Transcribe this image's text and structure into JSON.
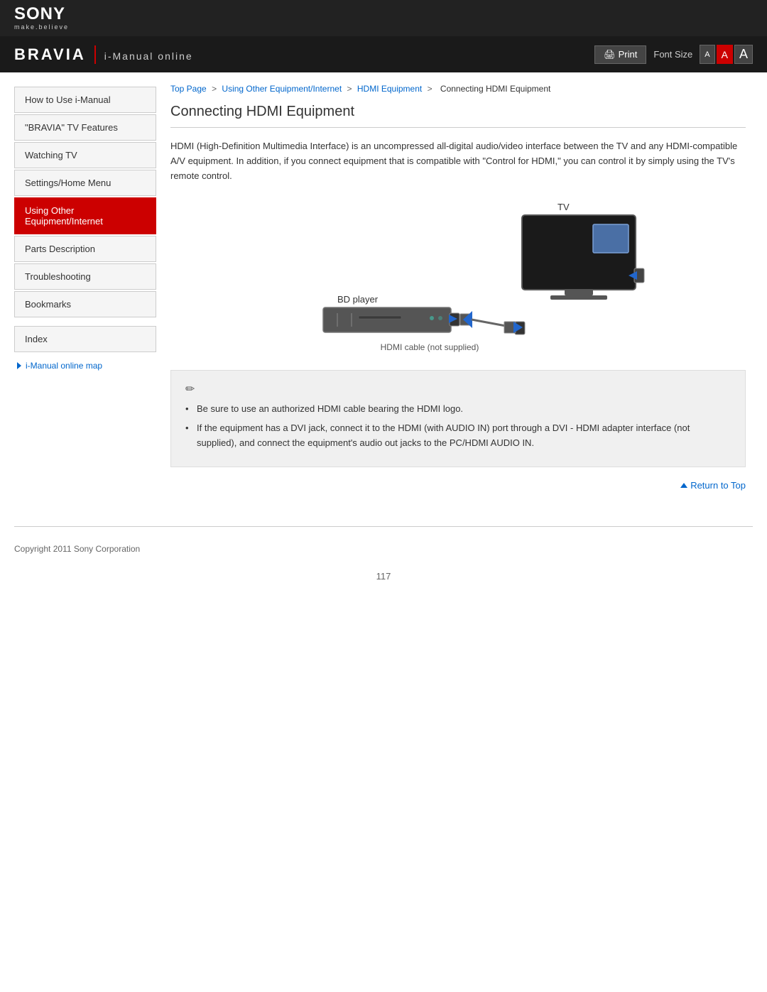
{
  "header": {
    "sony_logo": "SONY",
    "sony_tagline": "make.believe",
    "bravia_text": "BRAVIA",
    "imanual_text": "i-Manual online",
    "print_label": "Print",
    "font_size_label": "Font Size",
    "font_size_options": [
      "A",
      "A",
      "A"
    ]
  },
  "sidebar": {
    "nav_items": [
      {
        "label": "How to Use i-Manual",
        "active": false
      },
      {
        "label": "\"BRAVIA\" TV Features",
        "active": false
      },
      {
        "label": "Watching TV",
        "active": false
      },
      {
        "label": "Settings/Home Menu",
        "active": false
      },
      {
        "label": "Using Other Equipment/Internet",
        "active": true
      },
      {
        "label": "Parts Description",
        "active": false
      },
      {
        "label": "Troubleshooting",
        "active": false
      },
      {
        "label": "Bookmarks",
        "active": false
      }
    ],
    "index_label": "Index",
    "map_link_label": "i-Manual online map"
  },
  "breadcrumb": {
    "top_page": "Top Page",
    "item2": "Using Other Equipment/Internet",
    "item3": "HDMI Equipment",
    "current": "Connecting HDMI Equipment"
  },
  "content": {
    "title": "Connecting HDMI Equipment",
    "description": "HDMI (High-Definition Multimedia Interface) is an uncompressed all-digital audio/video interface between the TV and any HDMI-compatible A/V equipment. In addition, if you connect equipment that is compatible with \"Control for HDMI,\" you can control it by simply using the TV's remote control.",
    "diagram_labels": {
      "tv_label": "TV",
      "bd_player_label": "BD player",
      "cable_label": "HDMI cable (not supplied)"
    },
    "notes": [
      "Be sure to use an authorized HDMI cable bearing the HDMI logo.",
      "If the equipment has a DVI jack, connect it to the HDMI (with AUDIO IN) port through a DVI - HDMI adapter interface (not supplied), and connect the equipment's audio out jacks to the PC/HDMI AUDIO IN."
    ]
  },
  "return_to_top": "Return to Top",
  "footer": {
    "copyright": "Copyright 2011 Sony Corporation"
  },
  "page_number": "117"
}
